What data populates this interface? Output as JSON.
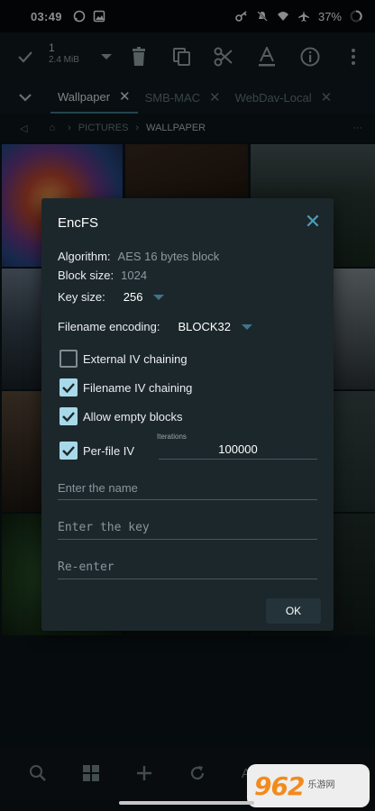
{
  "status_bar": {
    "time": "03:49",
    "battery": "37%",
    "icons": [
      "whatsapp-icon",
      "gallery-icon",
      "key-icon",
      "mute-icon",
      "wifi-icon",
      "airplane-icon",
      "battery-ring-icon"
    ]
  },
  "toolbar": {
    "selection_count": "1",
    "selection_size": "2.4 MiB",
    "actions": [
      "check-icon",
      "dropdown-icon",
      "delete-icon",
      "copy-icon",
      "cut-icon",
      "rename-icon",
      "info-icon",
      "more-icon"
    ]
  },
  "tabs": [
    {
      "label": "Wallpaper",
      "active": true
    },
    {
      "label": "SMB-MAC",
      "active": false
    },
    {
      "label": "WebDav-Local",
      "active": false
    }
  ],
  "breadcrumb": {
    "items": [
      "PICTURES",
      "WALLPAPER"
    ]
  },
  "dialog": {
    "title": "EncFS",
    "algorithm_label": "Algorithm:",
    "algorithm_value": "AES 16 bytes block",
    "block_size_label": "Block size:",
    "block_size_value": "1024",
    "key_size_label": "Key size:",
    "key_size_value": "256",
    "filename_encoding_label": "Filename encoding:",
    "filename_encoding_value": "BLOCK32",
    "checkboxes": [
      {
        "label": "External IV chaining",
        "checked": false
      },
      {
        "label": "Filename IV chaining",
        "checked": true
      },
      {
        "label": "Allow empty blocks",
        "checked": true
      },
      {
        "label": "Per-file IV",
        "checked": true
      }
    ],
    "iterations_label": "Iterations",
    "iterations_value": "100000",
    "name_placeholder": "Enter the name",
    "key_placeholder": "Enter the key",
    "reenter_placeholder": "Re-enter",
    "ok_label": "OK"
  },
  "bottom_bar": {
    "sort_label": "AZ",
    "icons": [
      "search-icon",
      "grid-icon",
      "add-icon",
      "refresh-icon",
      "sort-icon"
    ]
  },
  "watermark": {
    "logo_text": "962",
    "sub_text": "乐游网"
  },
  "colors": {
    "accent": "#4b9dbc",
    "checkbox_on": "#a8d9ea",
    "dialog_bg": "#1c272b"
  }
}
